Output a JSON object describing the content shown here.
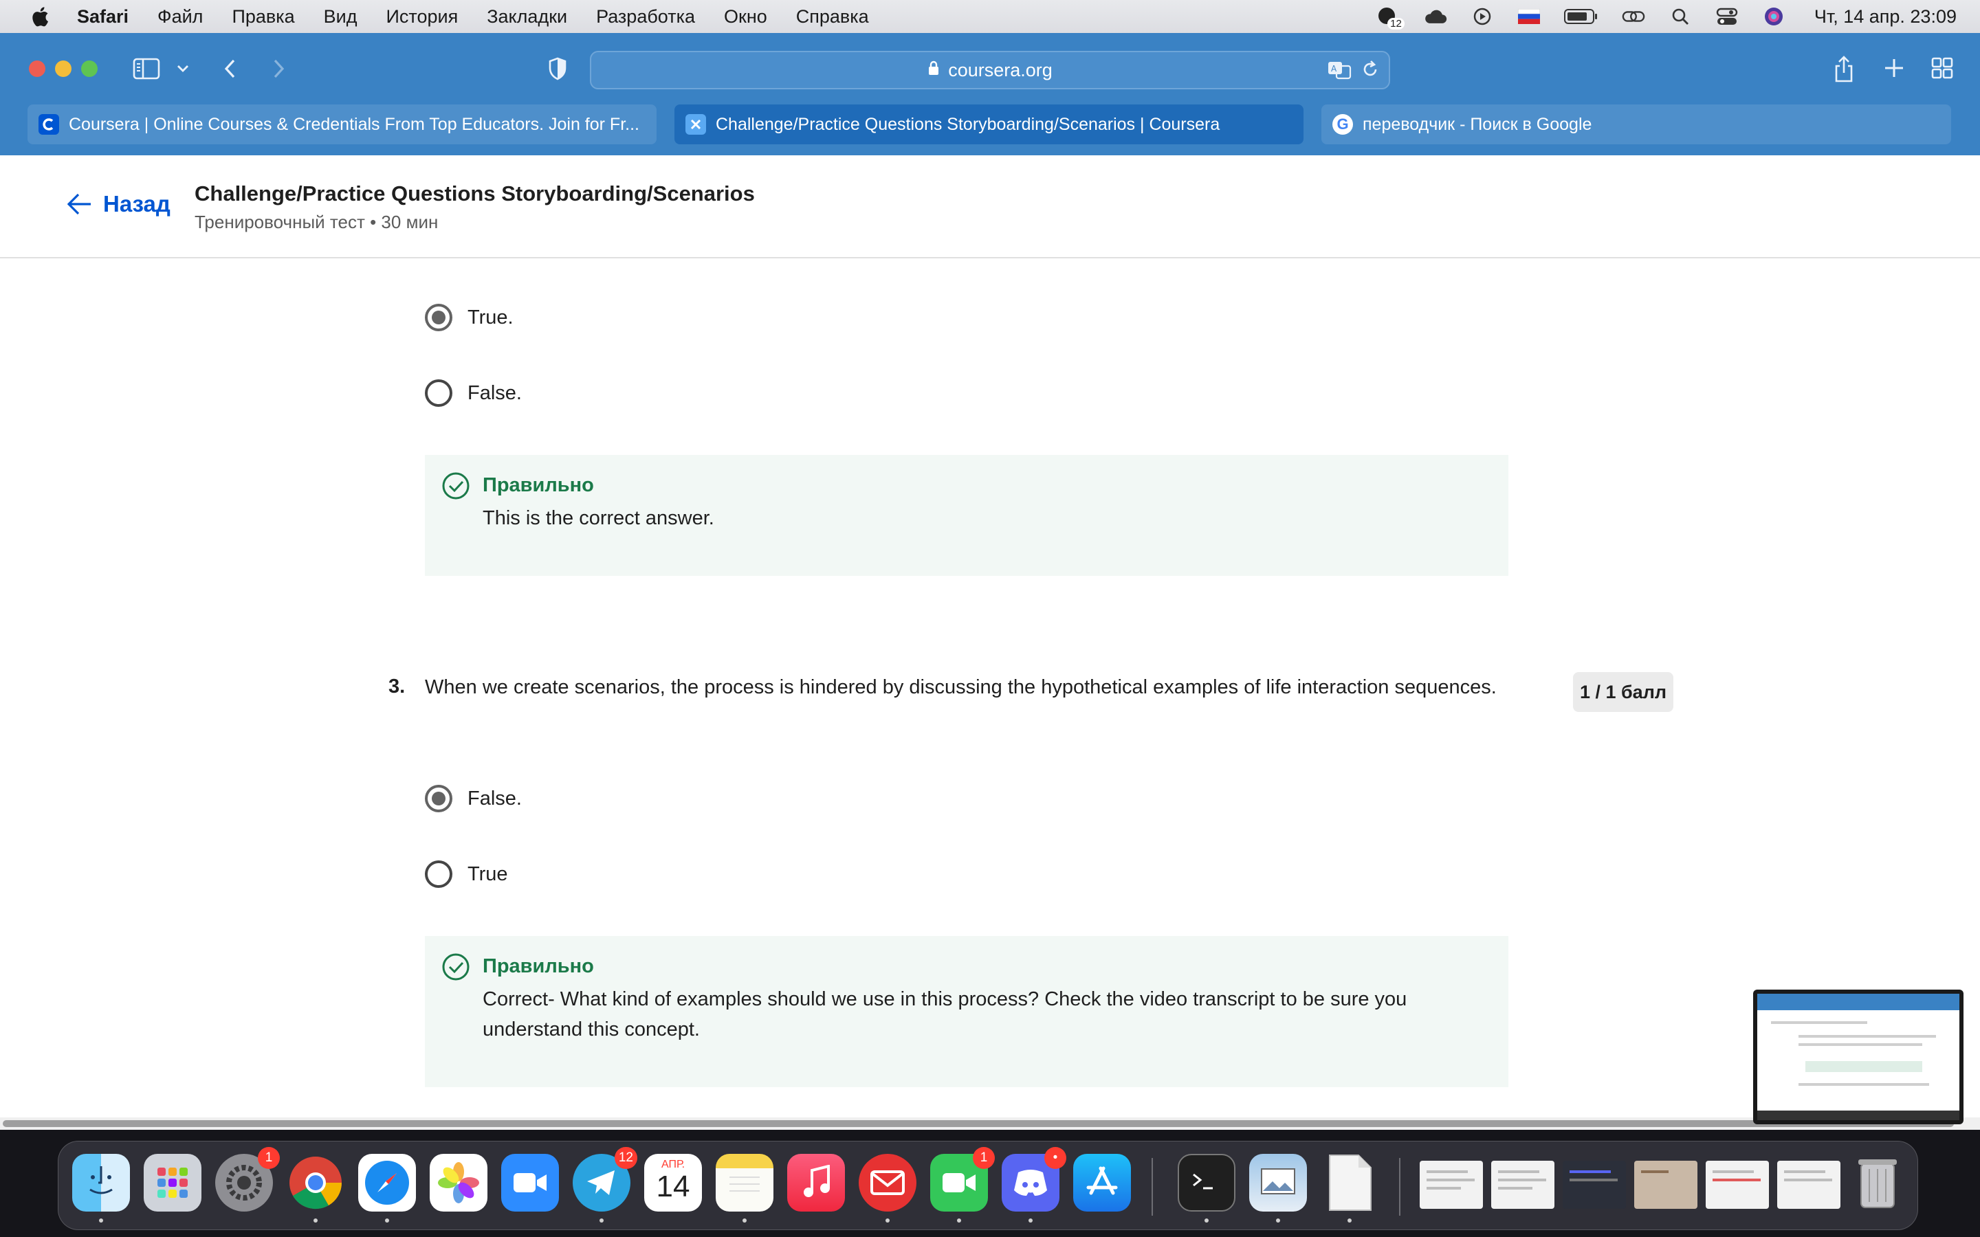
{
  "menubar": {
    "app_name": "Safari",
    "items": [
      "Файл",
      "Правка",
      "Вид",
      "История",
      "Закладки",
      "Разработка",
      "Окно",
      "Справка"
    ],
    "tray_badge": "12",
    "clock": "Чт, 14 апр.  23:09"
  },
  "browser": {
    "url": "coursera.org",
    "tabs": [
      {
        "label": "Coursera | Online Courses & Credentials From Top Educators. Join for Fr...",
        "favicon": "C"
      },
      {
        "label": "Challenge/Practice Questions Storyboarding/Scenarios | Coursera",
        "favicon": "coursera-x"
      },
      {
        "label": "переводчик - Поиск в Google",
        "favicon": "G"
      }
    ]
  },
  "header": {
    "back_label": "Назад",
    "title": "Challenge/Practice Questions Storyboarding/Scenarios",
    "subtitle": "Тренировочный тест • 30 мин"
  },
  "question2": {
    "options": [
      {
        "label": "True.",
        "selected": true
      },
      {
        "label": "False.",
        "selected": false
      }
    ],
    "feedback": {
      "title": "Правильно",
      "text": "This is the correct answer."
    }
  },
  "question3": {
    "number": "3.",
    "text": "When we create scenarios, the process is  hindered by discussing the hypothetical examples of  life interaction sequences.",
    "score": "1 / 1 балл",
    "options": [
      {
        "label": "False.",
        "selected": true
      },
      {
        "label": "True",
        "selected": false
      }
    ],
    "feedback": {
      "title": "Правильно",
      "text": "Correct- What kind of examples should we use in this process? Check the video transcript to be sure you understand this concept."
    }
  },
  "dock": {
    "apps": [
      "finder",
      "launchpad",
      "system-settings",
      "chrome",
      "safari",
      "photos",
      "zoom",
      "telegram",
      "calendar",
      "notes",
      "music",
      "mail",
      "facetime",
      "discord",
      "app-store"
    ],
    "badges": {
      "system-settings": "1",
      "telegram": "12",
      "facetime": "1",
      "discord": "•"
    },
    "calendar_month": "АПР.",
    "calendar_day": "14"
  },
  "colors": {
    "accent": "#0056d2",
    "correct": "#1b7a49",
    "feedback_bg": "#f2f8f5",
    "safari_chrome": "#3a82c4"
  }
}
